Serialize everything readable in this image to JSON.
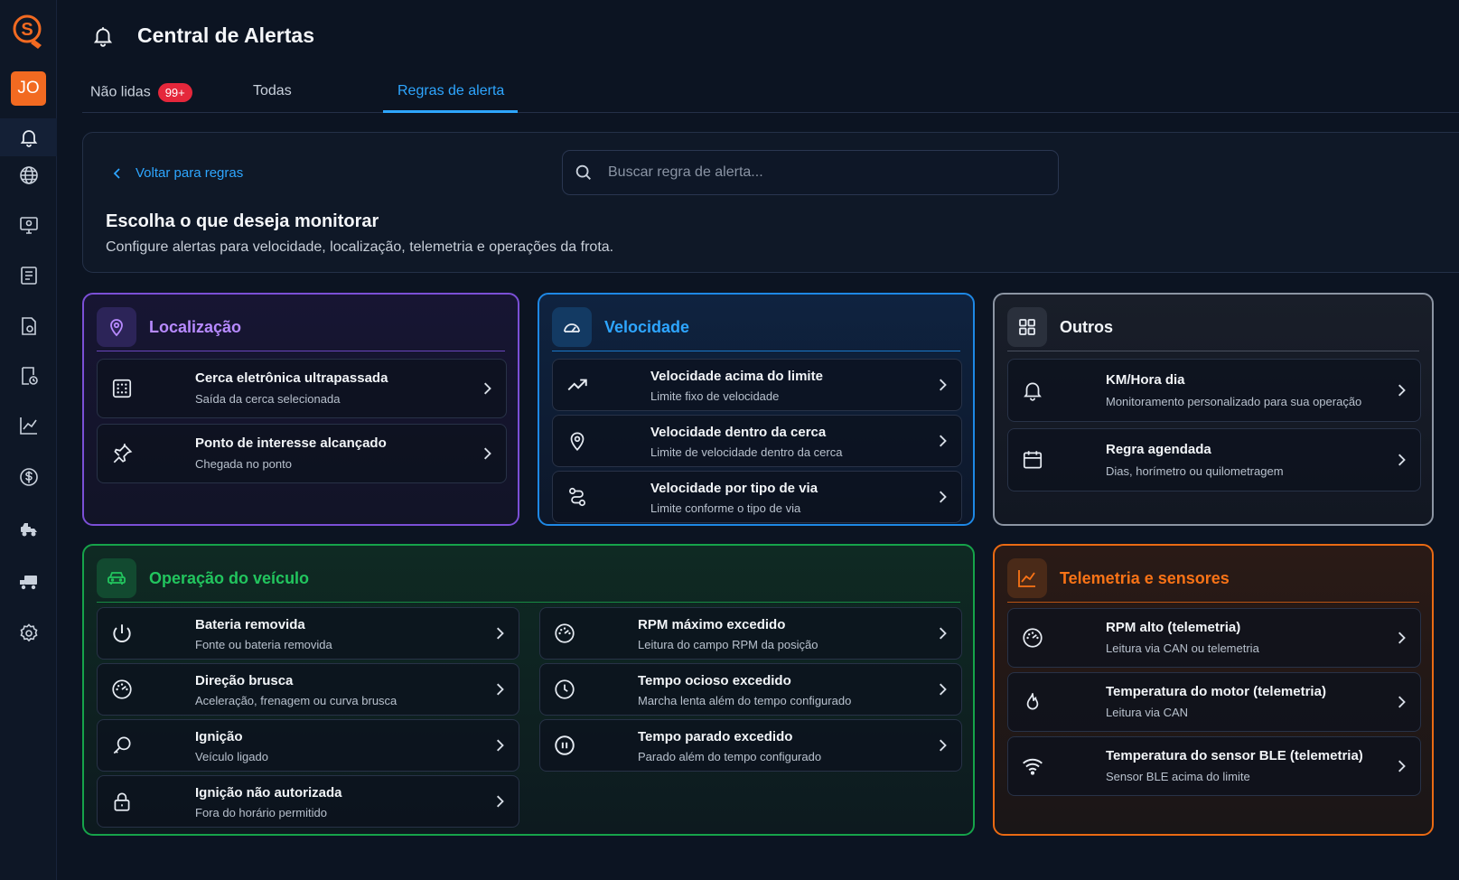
{
  "sidebar": {
    "avatar_initials": "JO",
    "logo_letter": "S",
    "accent": "#f26a21"
  },
  "header": {
    "title": "Central de Alertas"
  },
  "tabs": [
    {
      "label": "Não lidas",
      "badge": "99+"
    },
    {
      "label": "Todas"
    },
    {
      "label": "Regras de alerta",
      "active": true
    }
  ],
  "panel": {
    "back_label": "Voltar para regras",
    "search_placeholder": "Buscar regra de alerta...",
    "title": "Escolha o que deseja monitorar",
    "subtitle": "Configure alertas para velocidade, localização, telemetria e operações da frota."
  },
  "groups": {
    "localizacao": {
      "title": "Localização",
      "color": "#a66cff",
      "items": [
        {
          "title": "Cerca eletrônica ultrapassada",
          "desc": "Saída da cerca selecionada",
          "icon": "fence-icon"
        },
        {
          "title": "Ponto de interesse alcançado",
          "desc": "Chegada no ponto",
          "icon": "pin-icon"
        }
      ]
    },
    "velocidade": {
      "title": "Velocidade",
      "color": "#2ea6ff",
      "items": [
        {
          "title": "Velocidade acima do limite",
          "desc": "Limite fixo de velocidade",
          "icon": "trend-up-icon"
        },
        {
          "title": "Velocidade dentro da cerca",
          "desc": "Limite de velocidade dentro da cerca",
          "icon": "location-icon"
        },
        {
          "title": "Velocidade por tipo de via",
          "desc": "Limite conforme o tipo de via",
          "icon": "route-icon"
        }
      ]
    },
    "outros": {
      "title": "Outros",
      "color": "#9aa3b2",
      "items": [
        {
          "title": "KM/Hora dia",
          "desc": "Monitoramento personalizado para sua operação",
          "icon": "bell-icon"
        },
        {
          "title": "Regra agendada",
          "desc": "Dias, horímetro ou quilometragem",
          "icon": "calendar-icon"
        }
      ]
    },
    "operacao": {
      "title": "Operação do veículo",
      "color": "#22c55e",
      "items": [
        {
          "title": "Bateria removida",
          "desc": "Fonte ou bateria removida",
          "icon": "power-icon"
        },
        {
          "title": "Direção brusca",
          "desc": "Aceleração, frenagem ou curva brusca",
          "icon": "gauge-icon"
        },
        {
          "title": "Ignição",
          "desc": "Veículo ligado",
          "icon": "key-icon"
        },
        {
          "title": "Ignição não autorizada",
          "desc": "Fora do horário permitido",
          "icon": "lock-icon"
        },
        {
          "title": "RPM máximo excedido",
          "desc": "Leitura do campo RPM da posição",
          "icon": "gauge-icon"
        },
        {
          "title": "Tempo ocioso excedido",
          "desc": "Marcha lenta além do tempo configurado",
          "icon": "clock-icon"
        },
        {
          "title": "Tempo parado excedido",
          "desc": "Parado além do tempo configurado",
          "icon": "pause-icon"
        }
      ]
    },
    "telemetria": {
      "title": "Telemetria e sensores",
      "color": "#f97316",
      "items": [
        {
          "title": "RPM alto (telemetria)",
          "desc": "Leitura via CAN ou telemetria",
          "icon": "gauge-icon"
        },
        {
          "title": "Temperatura do motor (telemetria)",
          "desc": "Leitura via CAN",
          "icon": "flame-icon"
        },
        {
          "title": "Temperatura do sensor BLE (telemetria)",
          "desc": "Sensor BLE acima do limite",
          "icon": "wifi-icon"
        }
      ]
    }
  }
}
